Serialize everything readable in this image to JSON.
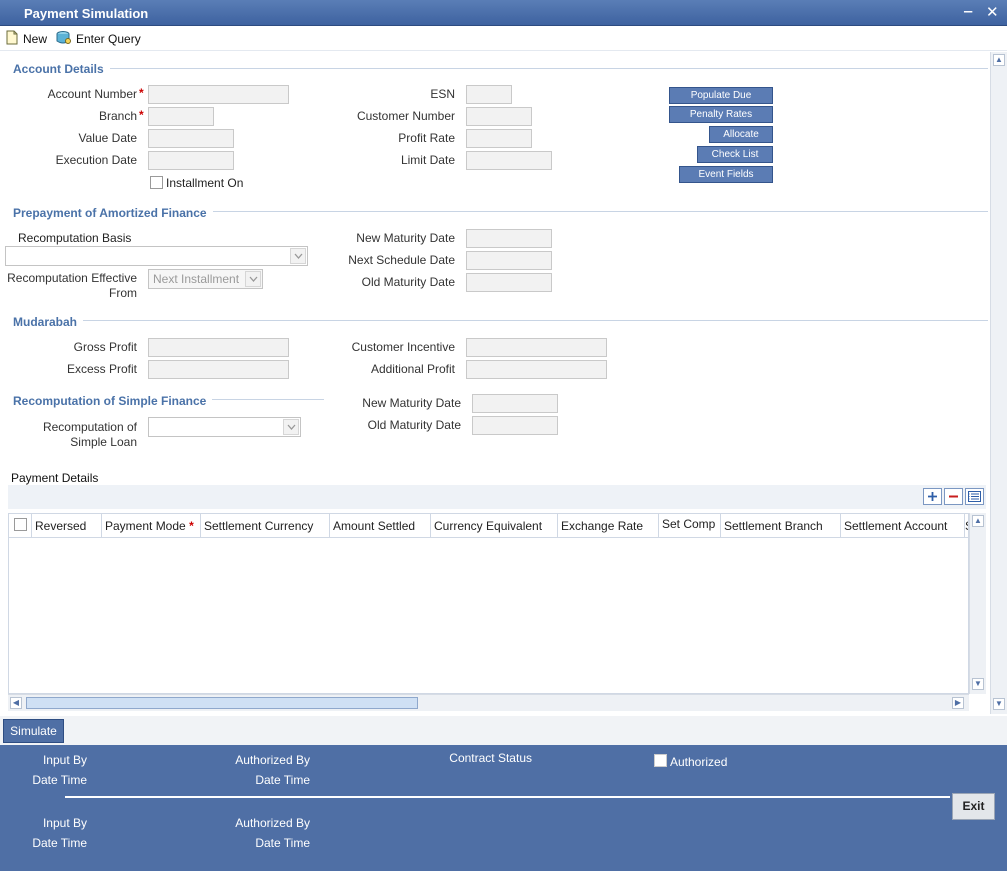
{
  "window": {
    "title": "Payment Simulation",
    "minimize": "‒",
    "close": "✕"
  },
  "toolbar": {
    "new_label": "New",
    "enter_query_label": "Enter Query"
  },
  "account_details": {
    "section_title": "Account Details",
    "account_number_label": "Account Number",
    "branch_label": "Branch",
    "value_date_label": "Value Date",
    "execution_date_label": "Execution Date",
    "installment_on_label": "Installment On",
    "esn_label": "ESN",
    "customer_number_label": "Customer Number",
    "profit_rate_label": "Profit Rate",
    "limit_date_label": "Limit Date",
    "required_mark": "*"
  },
  "action_buttons": {
    "populate_due": "Populate Due",
    "penalty_rates": "Penalty Rates",
    "allocate": "Allocate",
    "check_list": "Check List",
    "event_fields": "Event Fields"
  },
  "prepayment": {
    "section_title": "Prepayment of Amortized Finance",
    "recomputation_basis_label": "Recomputation Basis",
    "recomputation_effective_label_1": "Recomputation Effective",
    "recomputation_effective_label_2": "From",
    "recomputation_effective_value": "Next Installment",
    "new_maturity_date_label": "New Maturity Date",
    "next_schedule_date_label": "Next Schedule Date",
    "old_maturity_date_label": "Old Maturity Date"
  },
  "mudarabah": {
    "section_title": "Mudarabah",
    "gross_profit_label": "Gross Profit",
    "excess_profit_label": "Excess Profit",
    "customer_incentive_label": "Customer Incentive",
    "additional_profit_label": "Additional Profit"
  },
  "simple_finance": {
    "section_title": "Recomputation of Simple Finance",
    "recomputation_label_1": "Recomputation of",
    "recomputation_label_2": "Simple Loan",
    "new_maturity_date_label": "New Maturity Date",
    "old_maturity_date_label": "Old Maturity Date"
  },
  "payment_details": {
    "title": "Payment Details",
    "columns": [
      "Reversed",
      "Payment Mode",
      "Settlement Currency",
      "Amount Settled",
      "Currency Equivalent",
      "Exchange Rate",
      "Set Comp",
      "Settlement Branch",
      "Settlement Account",
      "S"
    ],
    "required_column_index": 1
  },
  "simulate_label": "Simulate",
  "footer": {
    "input_by": "Input By",
    "date_time": "Date Time",
    "authorized_by": "Authorized By",
    "contract_status": "Contract Status",
    "authorized": "Authorized",
    "exit": "Exit"
  },
  "colors": {
    "accent": "#4f6fa5",
    "section_title": "#4a72a8",
    "required": "#cc0000"
  }
}
